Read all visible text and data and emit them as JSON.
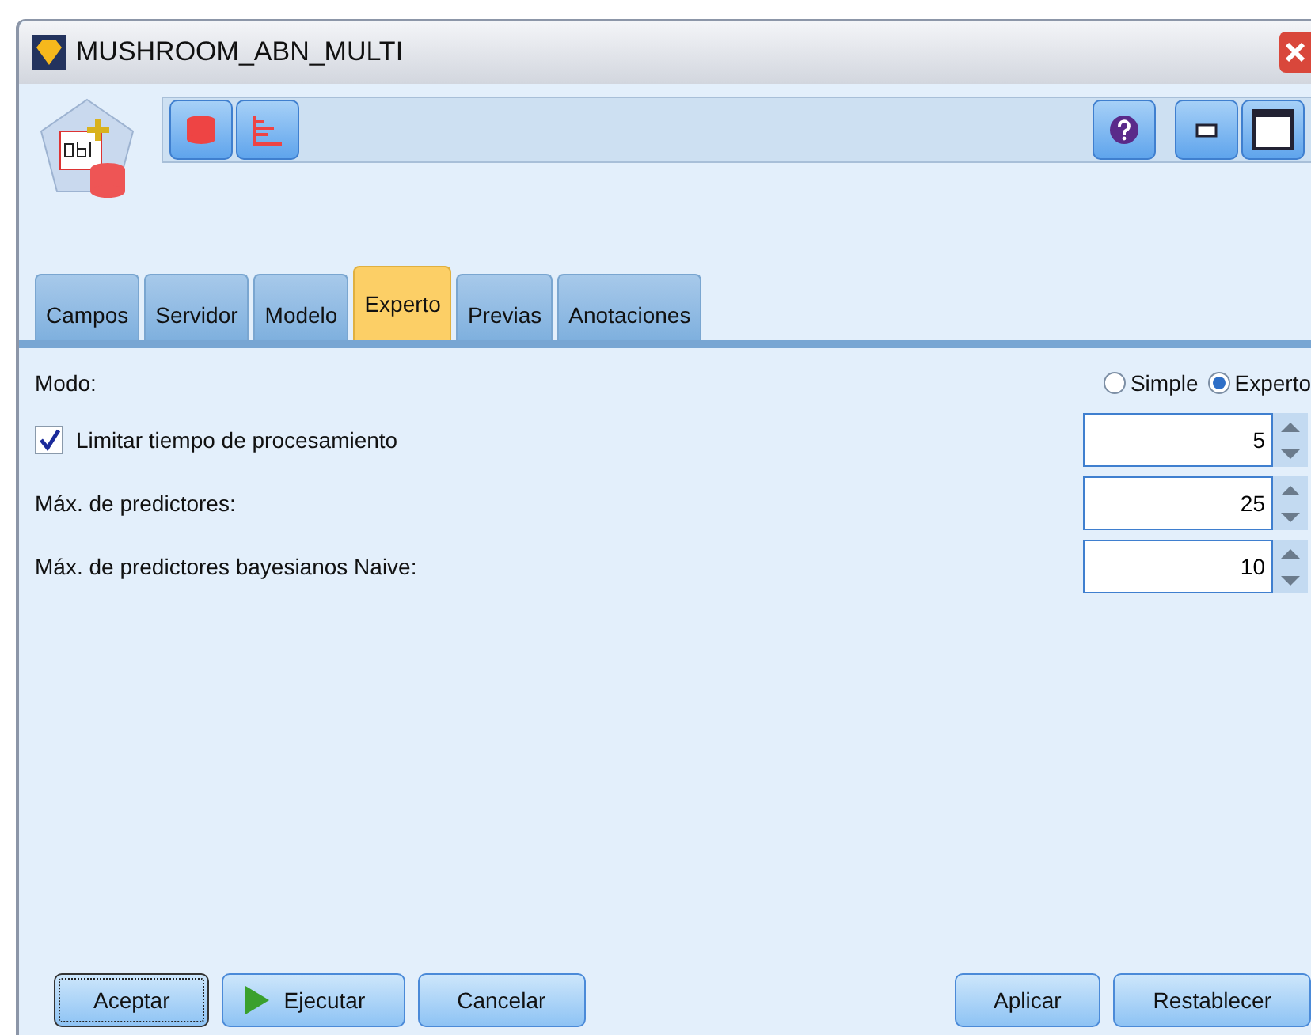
{
  "window": {
    "title": "MUSHROOM_ABN_MULTI"
  },
  "tabs": [
    {
      "label": "Campos",
      "selected": false
    },
    {
      "label": "Servidor",
      "selected": false
    },
    {
      "label": "Modelo",
      "selected": false
    },
    {
      "label": "Experto",
      "selected": true
    },
    {
      "label": "Previas",
      "selected": false
    },
    {
      "label": "Anotaciones",
      "selected": false
    }
  ],
  "mode": {
    "label": "Modo:",
    "options": [
      {
        "label": "Simple",
        "selected": false
      },
      {
        "label": "Experto",
        "selected": true
      }
    ]
  },
  "settings": [
    {
      "kind": "checkbox",
      "label": "Limitar tiempo de procesamiento",
      "checked": true,
      "value": "5"
    },
    {
      "kind": "plain",
      "label": "Máx. de predictores:",
      "value": "25"
    },
    {
      "kind": "plain",
      "label": "Máx. de predictores bayesianos Naive:",
      "value": "10"
    }
  ],
  "buttons_left": [
    {
      "label": "Aceptar",
      "kind": "default"
    },
    {
      "label": "Ejecutar",
      "kind": "run"
    },
    {
      "label": "Cancelar"
    }
  ],
  "buttons_right": [
    {
      "label": "Aplicar"
    },
    {
      "label": "Restablecer"
    }
  ]
}
